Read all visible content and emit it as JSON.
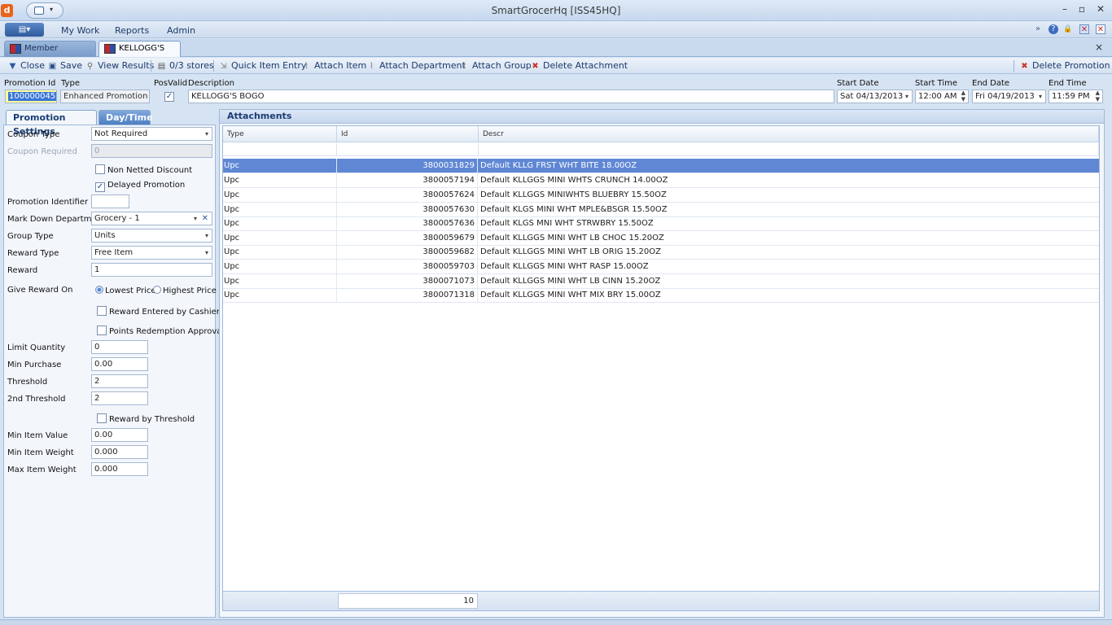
{
  "window": {
    "title": "SmartGrocerHq [ISS45HQ]",
    "app_icon": "d",
    "minimize": "–",
    "maximize": "▫",
    "close": "✕"
  },
  "menu": {
    "items": [
      "My Work",
      "Reports",
      "Admin"
    ],
    "app_menu_icon": "▤▾"
  },
  "right_icons": {
    "expand": "»",
    "help": "?",
    "lock": "🔒",
    "close_doc": "✕",
    "close_all": "✕",
    "doc_close": "×"
  },
  "tabs": [
    {
      "label": "Member Promotions",
      "active": false
    },
    {
      "label": "KELLOGG'S BOGO",
      "active": true
    }
  ],
  "toolbar": {
    "close": "Close",
    "save": "Save",
    "view_results": "View Results",
    "stores": "0/3 stores",
    "quick_item_entry": "Quick Item Entry",
    "attach_item": "Attach Item",
    "attach_department": "Attach Department",
    "attach_group": "Attach Group",
    "delete_attachment": "Delete Attachment",
    "delete_promotion": "Delete Promotion"
  },
  "header": {
    "promotion_id_label": "Promotion Id",
    "promotion_id": "100000045",
    "type_label": "Type",
    "type": "Enhanced Promotion",
    "posvalid_label": "PosValid",
    "posvalid": true,
    "description_label": "Description",
    "description": "KELLOGG'S BOGO",
    "start_date_label": "Start Date",
    "start_date": "Sat 04/13/2013",
    "start_time_label": "Start Time",
    "start_time": "12:00 AM",
    "end_date_label": "End Date",
    "end_date": "Fri 04/19/2013",
    "end_time_label": "End Time",
    "end_time": "11:59 PM"
  },
  "left_tabs": {
    "settings": "Promotion Settings",
    "daytime": "Day/Time"
  },
  "settings": {
    "coupon_type_label": "Coupon Type",
    "coupon_type": "Not Required",
    "coupon_required_label": "Coupon Required",
    "coupon_required": "0",
    "non_netted_label": "Non Netted Discount",
    "non_netted": false,
    "delayed_label": "Delayed Promotion",
    "delayed": true,
    "promo_identifier_label": "Promotion Identifier",
    "promo_identifier": "",
    "markdown_dept_label": "Mark Down Department",
    "markdown_dept": "Grocery - 1",
    "group_type_label": "Group Type",
    "group_type": "Units",
    "reward_type_label": "Reward Type",
    "reward_type": "Free Item",
    "reward_label": "Reward",
    "reward": "1",
    "give_reward_label": "Give Reward On",
    "lowest_price": "Lowest Price",
    "highest_price": "Highest Price",
    "reward_cashiers_label": "Reward Entered by Cashiers",
    "reward_cashiers": false,
    "points_redemption_label": "Points Redemption Approval",
    "points_redemption": false,
    "limit_qty_label": "Limit Quantity",
    "limit_qty": "0",
    "min_purchase_label": "Min Purchase",
    "min_purchase": "0.00",
    "threshold_label": "Threshold",
    "threshold": "2",
    "threshold2_label": "2nd Threshold",
    "threshold2": "2",
    "reward_threshold_label": "Reward by Threshold",
    "reward_threshold": false,
    "min_item_value_label": "Min Item Value",
    "min_item_value": "0.00",
    "min_item_weight_label": "Min Item Weight",
    "min_item_weight": "0.000",
    "max_item_weight_label": "Max Item Weight",
    "max_item_weight": "0.000"
  },
  "attachments": {
    "title": "Attachments",
    "columns": [
      "Type",
      "Id",
      "Descr"
    ],
    "rows": [
      {
        "type": "Upc",
        "id": "3800031829",
        "descr": "Default KLLG FRST WHT BITE 18.00OZ"
      },
      {
        "type": "Upc",
        "id": "3800057194",
        "descr": "Default KLLGGS MINI WHTS CRUNCH 14.00OZ"
      },
      {
        "type": "Upc",
        "id": "3800057624",
        "descr": "Default KLLGGS MINIWHTS BLUEBRY 15.50OZ"
      },
      {
        "type": "Upc",
        "id": "3800057630",
        "descr": "Default KLGS MINI WHT MPLE&BSGR 15.50OZ"
      },
      {
        "type": "Upc",
        "id": "3800057636",
        "descr": "Default KLGS MNI WHT STRWBRY 15.50OZ"
      },
      {
        "type": "Upc",
        "id": "3800059679",
        "descr": "Default KLLGGS MINI WHT LB CHOC 15.20OZ"
      },
      {
        "type": "Upc",
        "id": "3800059682",
        "descr": "Default KLLGGS MINI WHT LB ORIG 15.20OZ"
      },
      {
        "type": "Upc",
        "id": "3800059703",
        "descr": "Default KLLGGS MINI WHT RASP 15.00OZ"
      },
      {
        "type": "Upc",
        "id": "3800071073",
        "descr": "Default KLLGGS MINI WHT LB CINN 15.20OZ"
      },
      {
        "type": "Upc",
        "id": "3800071318",
        "descr": "Default KLLGGS MINI WHT MIX BRY 15.00OZ"
      }
    ],
    "count": "10"
  }
}
